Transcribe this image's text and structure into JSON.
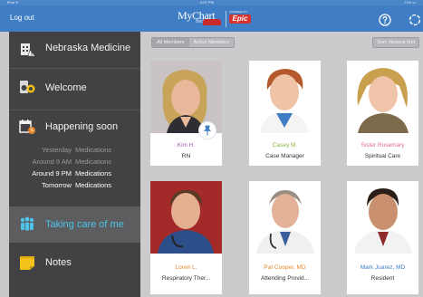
{
  "status_bar": {
    "carrier": "iPad ✈",
    "time": "4:07 PM",
    "battery": "71% ▭"
  },
  "header": {
    "logout_label": "Log out",
    "logo": {
      "brand": "MyChart",
      "sub": "Bedside",
      "powered_by": "POWERED BY",
      "epic": "Epic"
    }
  },
  "sidebar": {
    "hospital": "Nebraska Medicine",
    "welcome": "Welcome",
    "happening_soon": "Happening soon",
    "schedule": [
      {
        "time": "Yesterday",
        "label": "Medications"
      },
      {
        "time": "Around 9 AM",
        "label": "Medications"
      },
      {
        "time": "Around 9 PM",
        "label": "Medications"
      },
      {
        "time": "Tomorrow",
        "label": "Medications"
      }
    ],
    "taking_care": "Taking care of me",
    "notes": "Notes",
    "active_color": "#4cc3e7"
  },
  "main": {
    "tabs": [
      "All Members",
      "Active Members"
    ],
    "sort_label": "Sort: Newest first",
    "care_team": [
      {
        "name": "Kim H.",
        "role": "RN",
        "name_color": "#a05fb0"
      },
      {
        "name": "Casey M.",
        "role": "Case Manager",
        "name_color": "#8bb640"
      },
      {
        "name": "Sister Rosemary",
        "role": "Spiritual Care",
        "name_color": "#e06a8c"
      },
      {
        "name": "Loren L.",
        "role": "Respiratory Ther...",
        "name_color": "#e8872d"
      },
      {
        "name": "Pat Cooper, MD",
        "role": "Attending Provid...",
        "name_color": "#e8872d"
      },
      {
        "name": "Mark Juarez, MD",
        "role": "Resident",
        "name_color": "#3f7ec5"
      }
    ]
  }
}
